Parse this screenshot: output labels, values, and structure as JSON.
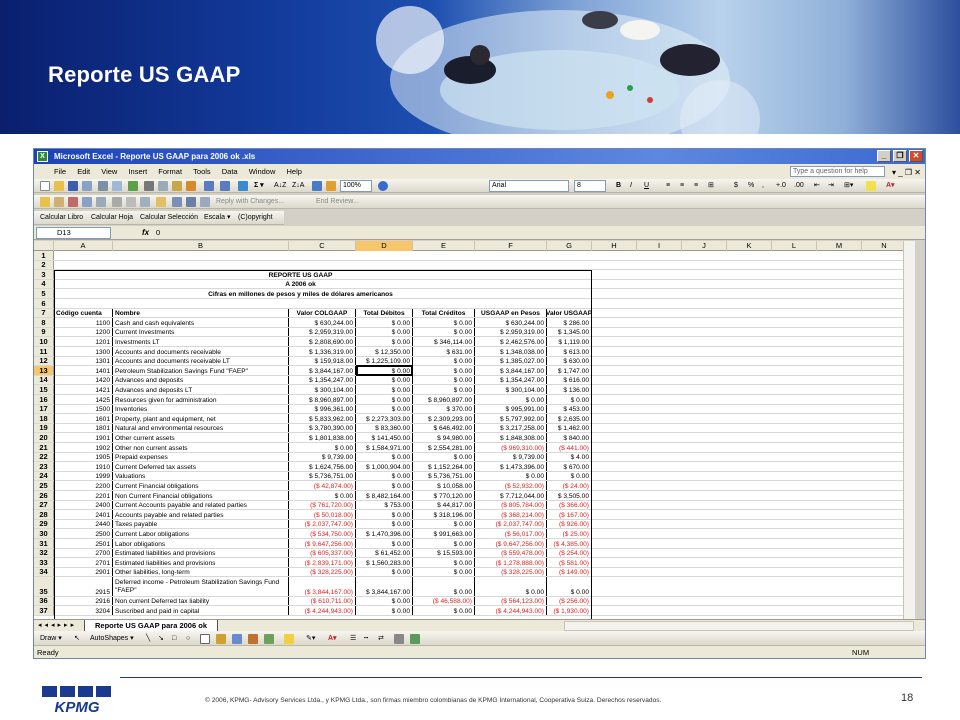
{
  "slide": {
    "title": "Reporte US GAAP",
    "page_number": "18",
    "copyright": "© 2006, KPMG- Advisory Services Ltda., y KPMG Ltda., son firmas miembro colombianas  de KPMG International,  Cooperativa  Suiza.  Derechos reservados."
  },
  "excel": {
    "window_title": "Microsoft Excel - Reporte US GAAP para 2006 ok .xls",
    "menu": [
      "File",
      "Edit",
      "View",
      "Insert",
      "Format",
      "Tools",
      "Data",
      "Window",
      "Help"
    ],
    "help_placeholder": "Type a question for help",
    "toolbar": {
      "zoom": "100%",
      "font": "Arial",
      "font_size": "8",
      "reply_label": "Reply with Changes...",
      "end_review_label": "End Review..."
    },
    "custom_toolbar": [
      "Calcular Libro",
      "Calcular Hoja",
      "Calcular Selección",
      "Escala ▾",
      "(C)opyright"
    ],
    "namebox": "D13",
    "formula_value": "0",
    "columns": [
      "A",
      "B",
      "C",
      "D",
      "E",
      "F",
      "G",
      "H",
      "I",
      "J",
      "K",
      "L",
      "M",
      "N"
    ],
    "selected_column": "D",
    "selected_row": "13",
    "report_title": [
      "REPORTE US GAAP",
      "A 2006 ok",
      "Cifras en millones de pesos y miles de dólares americanos"
    ],
    "headers": [
      "Código cuenta",
      "Nombre",
      "Valor COLGAAP",
      "Total Débitos",
      "Total Créditos",
      "USGAAP en Pesos",
      "Valor USGAAP"
    ],
    "rows": [
      {
        "n": "8",
        "code": "1100",
        "name": "Cash and cash equivalents",
        "c": "$ 630,244.00",
        "d": "$ 0.00",
        "e": "$ 0.00",
        "f": "$ 630,244.00",
        "g": "$ 286.00"
      },
      {
        "n": "9",
        "code": "1200",
        "name": "Current Investments",
        "c": "$ 2,959,319.00",
        "d": "$ 0.00",
        "e": "$ 0.00",
        "f": "$ 2,959,319.00",
        "g": "$ 1,345.00"
      },
      {
        "n": "10",
        "code": "1201",
        "name": "Investments LT",
        "c": "$ 2,808,690.00",
        "d": "$ 0.00",
        "e": "$ 346,114.00",
        "f": "$ 2,462,576.00",
        "g": "$ 1,119.00"
      },
      {
        "n": "11",
        "code": "1300",
        "name": "Accounts and documents receivable",
        "c": "$ 1,336,319.00",
        "d": "$ 12,350.00",
        "e": "$ 631.00",
        "f": "$ 1,348,038.00",
        "g": "$ 613.00"
      },
      {
        "n": "12",
        "code": "1301",
        "name": "Accounts and documents receivable LT",
        "c": "$ 159,918.00",
        "d": "$ 1,225,109.00",
        "e": "$ 0.00",
        "f": "$ 1,385,027.00",
        "g": "$ 630.00"
      },
      {
        "n": "13",
        "code": "1401",
        "name": "Petroleum Stabilization Savings Fund \"FAEP\"",
        "c": "$ 3,844,167.00",
        "d": "$ 0.00",
        "e": "$ 0.00",
        "f": "$ 3,844,167.00",
        "g": "$ 1,747.00"
      },
      {
        "n": "14",
        "code": "1420",
        "name": "Advances and deposits",
        "c": "$ 1,354,247.00",
        "d": "$ 0.00",
        "e": "$ 0.00",
        "f": "$ 1,354,247.00",
        "g": "$ 616.00"
      },
      {
        "n": "15",
        "code": "1421",
        "name": "Advances and deposits LT",
        "c": "$ 300,104.00",
        "d": "$ 0.00",
        "e": "$ 0.00",
        "f": "$ 300,104.00",
        "g": "$ 136.00"
      },
      {
        "n": "16",
        "code": "1425",
        "name": "Resources given for administration",
        "c": "$ 8,960,897.00",
        "d": "$ 0.00",
        "e": "$ 8,960,897.00",
        "f": "$ 0.00",
        "g": "$ 0.00"
      },
      {
        "n": "17",
        "code": "1500",
        "name": "Inventories",
        "c": "$ 996,361.00",
        "d": "$ 0.00",
        "e": "$ 370.00",
        "f": "$ 995,991.00",
        "g": "$ 453.00"
      },
      {
        "n": "18",
        "code": "1601",
        "name": "Property, plant and equipment, net",
        "c": "$ 5,833,962.00",
        "d": "$ 2,273,303.00",
        "e": "$ 2,309,293.00",
        "f": "$ 5,797,992.00",
        "g": "$ 2,635.00"
      },
      {
        "n": "19",
        "code": "1801",
        "name": "Natural and environmental resources",
        "c": "$ 3,780,390.00",
        "d": "$ 83,360.00",
        "e": "$ 646,492.00",
        "f": "$ 3,217,258.00",
        "g": "$ 1,462.00"
      },
      {
        "n": "20",
        "code": "1901",
        "name": "Other current assets",
        "c": "$ 1,801,838.00",
        "d": "$ 141,450.00",
        "e": "$ 94,980.00",
        "f": "$ 1,848,308.00",
        "g": "$ 840.00"
      },
      {
        "n": "21",
        "code": "1902",
        "name": "Other non current assets",
        "c": "$ 0.00",
        "d": "$ 1,584,971.00",
        "e": "$ 2,554,281.00",
        "f": "($ 969,310.00)",
        "g": "($ 441.00)",
        "fneg": true,
        "gneg": true
      },
      {
        "n": "22",
        "code": "1905",
        "name": "Prepaid expenses",
        "c": "$ 9,739.00",
        "d": "$ 0.00",
        "e": "$ 0.00",
        "f": "$ 9,739.00",
        "g": "$ 4.00"
      },
      {
        "n": "23",
        "code": "1910",
        "name": "Current Deferred tax assets",
        "c": "$ 1,624,756.00",
        "d": "$ 1,000,904.00",
        "e": "$ 1,152,264.00",
        "f": "$ 1,473,396.00",
        "g": "$ 670.00"
      },
      {
        "n": "24",
        "code": "1999",
        "name": "Valuations",
        "c": "$ 5,736,751.00",
        "d": "$ 0.00",
        "e": "$ 5,736,751.00",
        "f": "$ 0.00",
        "g": "$ 0.00"
      },
      {
        "n": "25",
        "code": "2200",
        "name": "Current Financial obligations",
        "c": "($ 42,874.00)",
        "d": "$ 0.00",
        "e": "$ 10,058.00",
        "f": "($ 52,932.00)",
        "g": "($ 24.00)",
        "cneg": true,
        "fneg": true,
        "gneg": true
      },
      {
        "n": "26",
        "code": "2201",
        "name": "Non Current Financial obligations",
        "c": "$ 0.00",
        "d": "$ 8,482,164.00",
        "e": "$ 770,120.00",
        "f": "$ 7,712,044.00",
        "g": "$ 3,505.00"
      },
      {
        "n": "27",
        "code": "2400",
        "name": "Current Accounts payable and related parties",
        "c": "($ 761,720.00)",
        "d": "$ 753.00",
        "e": "$ 44,817.00",
        "f": "($ 805,784.00)",
        "g": "($ 366.00)",
        "cneg": true,
        "fneg": true,
        "gneg": true
      },
      {
        "n": "28",
        "code": "2401",
        "name": "Accounts payable and related parties",
        "c": "($ 50,018.00)",
        "d": "$ 0.00",
        "e": "$ 318,196.00",
        "f": "($ 368,214.00)",
        "g": "($ 167.00)",
        "cneg": true,
        "fneg": true,
        "gneg": true
      },
      {
        "n": "29",
        "code": "2440",
        "name": "Taxes payable",
        "c": "($ 2,037,747.00)",
        "d": "$ 0.00",
        "e": "$ 0.00",
        "f": "($ 2,037,747.00)",
        "g": "($ 926.00)",
        "cneg": true,
        "fneg": true,
        "gneg": true
      },
      {
        "n": "30",
        "code": "2500",
        "name": "Current Labor obligations",
        "c": "($ 534,750.00)",
        "d": "$ 1,470,396.00",
        "e": "$ 991,663.00",
        "f": "($ 56,017.00)",
        "g": "($ 25.00)",
        "cneg": true,
        "fneg": true,
        "gneg": true
      },
      {
        "n": "31",
        "code": "2501",
        "name": "Labor obligations",
        "c": "($ 9,647,256.00)",
        "d": "$ 0.00",
        "e": "$ 0.00",
        "f": "($ 9,647,256.00)",
        "g": "($ 4,385.00)",
        "cneg": true,
        "fneg": true,
        "gneg": true
      },
      {
        "n": "32",
        "code": "2700",
        "name": "Estimated liabilities and provisions",
        "c": "($ 605,337.00)",
        "d": "$ 61,452.00",
        "e": "$ 15,593.00",
        "f": "($ 559,478.00)",
        "g": "($ 254.00)",
        "cneg": true,
        "fneg": true,
        "gneg": true
      },
      {
        "n": "33",
        "code": "2701",
        "name": "Estimated liabilities and provisions",
        "c": "($ 2,839,171.00)",
        "d": "$ 1,560,283.00",
        "e": "$ 0.00",
        "f": "($ 1,278,888.00)",
        "g": "($ 581.00)",
        "cneg": true,
        "fneg": true,
        "gneg": true
      },
      {
        "n": "34",
        "code": "2901",
        "name": "Other liabilities, long-term",
        "c": "($ 328,225.00)",
        "d": "$ 0.00",
        "e": "$ 0.00",
        "f": "($ 328,225.00)",
        "g": "($ 149.00)",
        "cneg": true,
        "fneg": true,
        "gneg": true
      },
      {
        "n": "35",
        "code": "2915",
        "name": "Deferred income - Petroleum Stabilization Savings Fund \"FAEP\"",
        "c": "($ 3,844,167.00)",
        "d": "$ 3,844,167.00",
        "e": "$ 0.00",
        "f": "$ 0.00",
        "g": "$ 0.00",
        "cneg": true,
        "tall": true
      },
      {
        "n": "36",
        "code": "2916",
        "name": "Non current Deferred tax liability",
        "c": "($ 610,711.00)",
        "d": "$ 0.00",
        "e": "($ 46,588.00)",
        "f": "($ 564,123.00)",
        "g": "($ 256.00)",
        "cneg": true,
        "eneg": true,
        "fneg": true,
        "gneg": true
      },
      {
        "n": "37",
        "code": "3204",
        "name": "Suscribed and paid in capital",
        "c": "($ 4,244,943.00)",
        "d": "$ 0.00",
        "e": "$ 0.00",
        "f": "($ 4,244,943.00)",
        "g": "($ 1,930.00)",
        "cneg": true,
        "fneg": true,
        "gneg": true
      }
    ],
    "sheet_tab": "Reporte US GAAP para 2006 ok",
    "draw_label": "Draw ▾",
    "autoshapes_label": "AutoShapes ▾",
    "status_left": "Ready",
    "status_num": "NUM"
  }
}
